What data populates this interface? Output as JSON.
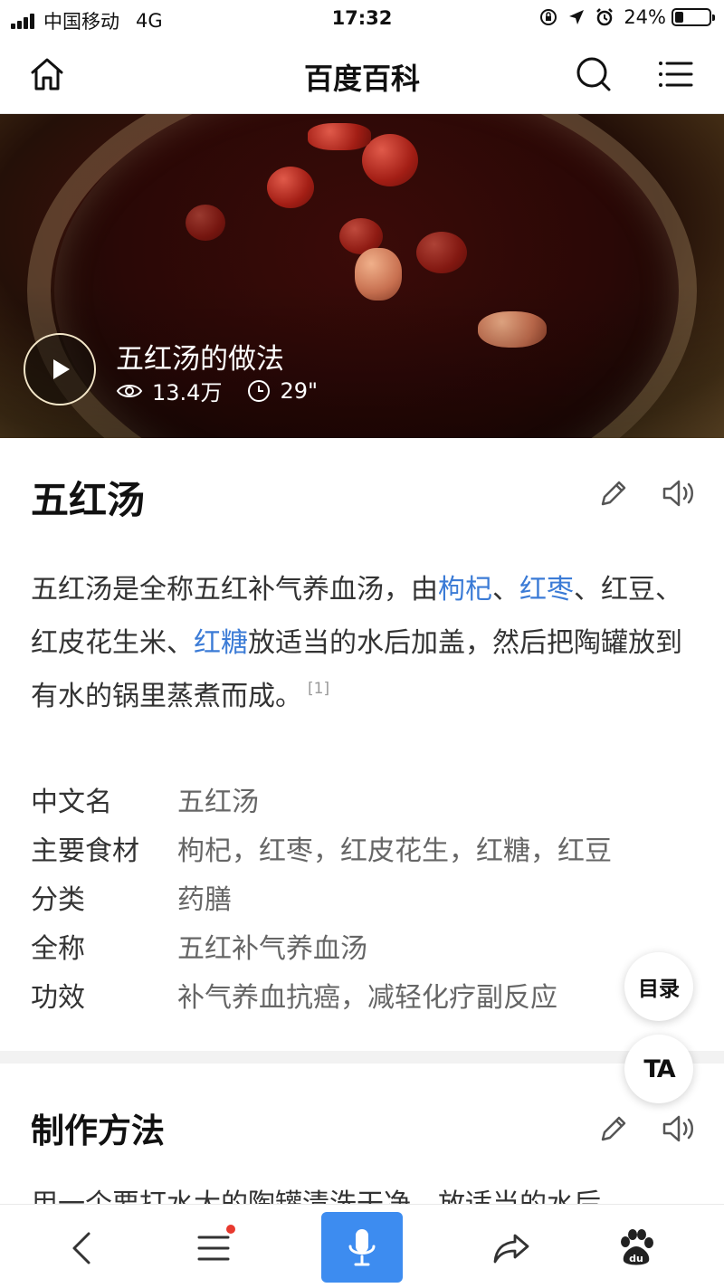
{
  "status_bar": {
    "carrier": "中国移动",
    "network": "4G",
    "time": "17:32",
    "battery": "24%",
    "battery_level": 0.24
  },
  "nav": {
    "title": "百度百科",
    "icons": [
      "home-icon",
      "search-icon",
      "menu-icon"
    ]
  },
  "video": {
    "title": "五红汤的做法",
    "views": "13.4万",
    "duration": "29\""
  },
  "article": {
    "title": "五红汤",
    "summary": {
      "p1": "五红汤是全称五红补气养血汤，由",
      "link1": "枸杞",
      "p2": "、",
      "link2": "红枣",
      "p3": "、红豆、红皮花生米、",
      "link3": "红糖",
      "p4": "放适当的水后加盖，然后把陶罐放到有水的锅里蒸煮而成。",
      "ref": "[1]"
    },
    "infobox": [
      {
        "key": "中文名",
        "value": "五红汤"
      },
      {
        "key": "主要食材",
        "value": "枸杞，红枣，红皮花生，红糖，红豆"
      },
      {
        "key": "分类",
        "value": "药膳"
      },
      {
        "key": "全称",
        "value": "五红补气养血汤"
      },
      {
        "key": "功效",
        "value": "补气养血抗癌，减轻化疗副反应"
      }
    ],
    "section_title": "制作方法",
    "section_peek": "用一个要打水大的陶罐清洗干净，放适当的水后"
  },
  "floating": {
    "toc": "目录",
    "ta": "TA"
  },
  "bottom_bar": {
    "icons": [
      "back-icon",
      "list-icon",
      "mic-icon",
      "share-icon",
      "baidu-paw-icon"
    ],
    "accent": "#3d8cf0"
  },
  "colors": {
    "link": "#3b7bd6",
    "notification_dot": "#e8392f"
  }
}
